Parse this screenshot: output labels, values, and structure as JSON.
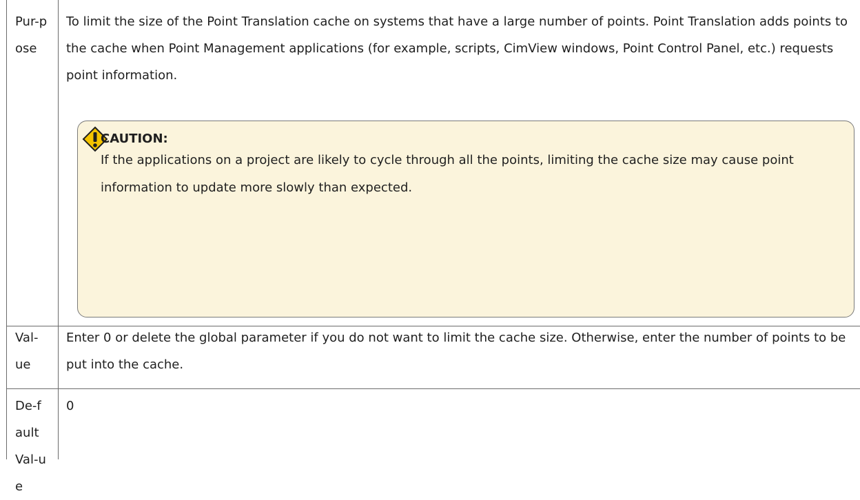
{
  "rows": [
    {
      "label": "Pur-pose",
      "text": "To limit the size of the Point Translation cache on systems that have a large number of points. Point Translation adds points to the cache when Point Management applications (for example, scripts, CimView windows, Point Control Panel, etc.) requests point information."
    },
    {
      "label": "Val-ue",
      "text": "Enter 0 or delete the global parameter if you do not want to limit the cache size. Otherwise, enter the number of points to be put into the cache."
    },
    {
      "label": "De-fault Val-ue",
      "text": "0"
    }
  ],
  "caution": {
    "icon": "warning-icon",
    "title": "CAUTION:",
    "text": "If the applications on a project are likely to cycle through all the points, limiting the cache size may cause point information to update more slowly than expected."
  },
  "colors": {
    "border": "#6b6b6b",
    "caution_bg": "#fbf4dc",
    "caution_border": "#7a7a7a",
    "icon_fill": "#f5c400"
  }
}
